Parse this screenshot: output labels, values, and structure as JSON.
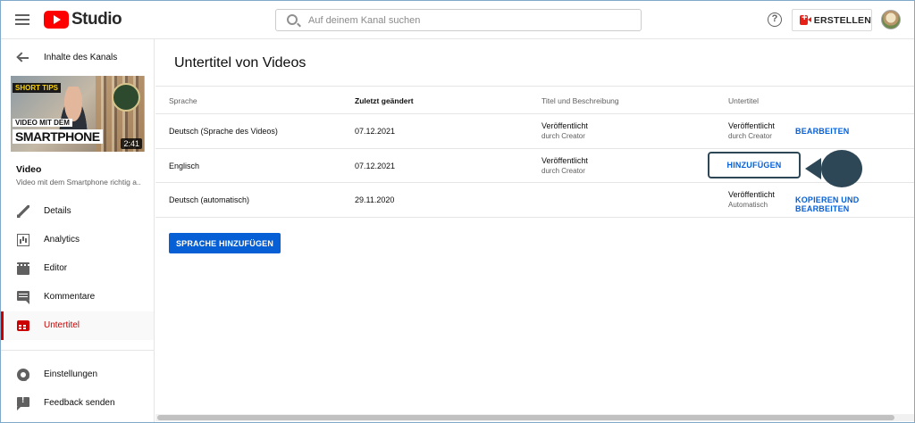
{
  "header": {
    "logo_text": "Studio",
    "search_placeholder": "Auf deinem Kanal suchen",
    "help_icon": "?",
    "create_label": "ERSTELLEN"
  },
  "sidebar": {
    "back_label": "Inhalte des Kanals",
    "thumbnail": {
      "badge": "SHORT TIPS",
      "title_line1": "VIDEO MIT DEM",
      "title_line2": "SMARTPHONE",
      "duration": "2:41"
    },
    "video_heading": "Video",
    "video_title": "Video mit dem Smartphone richtig a...",
    "items": [
      {
        "label": "Details",
        "icon": "pencil-icon"
      },
      {
        "label": "Analytics",
        "icon": "analytics-icon"
      },
      {
        "label": "Editor",
        "icon": "film-icon"
      },
      {
        "label": "Kommentare",
        "icon": "comment-icon"
      },
      {
        "label": "Untertitel",
        "icon": "subtitles-icon",
        "active": true
      }
    ],
    "bottom_items": [
      {
        "label": "Einstellungen",
        "icon": "gear-icon"
      },
      {
        "label": "Feedback senden",
        "icon": "feedback-icon"
      }
    ]
  },
  "main": {
    "title": "Untertitel von Videos",
    "columns": [
      "Sprache",
      "Zuletzt geändert",
      "Titel und Beschreibung",
      "Untertitel"
    ],
    "rows": [
      {
        "language": "Deutsch (Sprache des Videos)",
        "date": "07.12.2021",
        "title_status": "Veröffentlicht",
        "title_sub": "durch Creator",
        "subs_status": "Veröffentlicht",
        "subs_sub": "durch Creator",
        "action": "BEARBEITEN"
      },
      {
        "language": "Englisch",
        "date": "07.12.2021",
        "title_status": "Veröffentlicht",
        "title_sub": "durch Creator",
        "action": "HINZUFÜGEN"
      },
      {
        "language": "Deutsch (automatisch)",
        "date": "29.11.2020",
        "subs_status": "Veröffentlicht",
        "subs_sub": "Automatisch",
        "action": "KOPIEREN UND BEARBEITEN"
      }
    ],
    "add_language_label": "SPRACHE HINZUFÜGEN"
  },
  "colors": {
    "accent_blue": "#065fd4",
    "active_red": "#cc0000",
    "annotation_dark": "#2e4756"
  }
}
